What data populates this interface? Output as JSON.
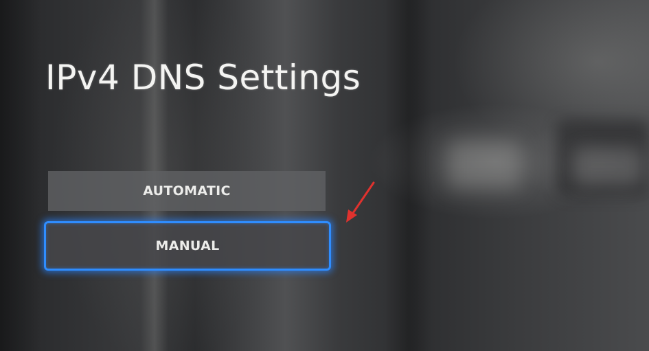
{
  "page": {
    "title": "IPv4 DNS Settings"
  },
  "options": [
    {
      "label": "AUTOMATIC",
      "selected": false
    },
    {
      "label": "MANUAL",
      "selected": true
    }
  ],
  "colors": {
    "focus_outline": "#2f8dff",
    "annotation_arrow": "#e0322e",
    "title_text": "#f4f4f2"
  },
  "icons": {
    "annotation": "red-arrow-icon"
  }
}
